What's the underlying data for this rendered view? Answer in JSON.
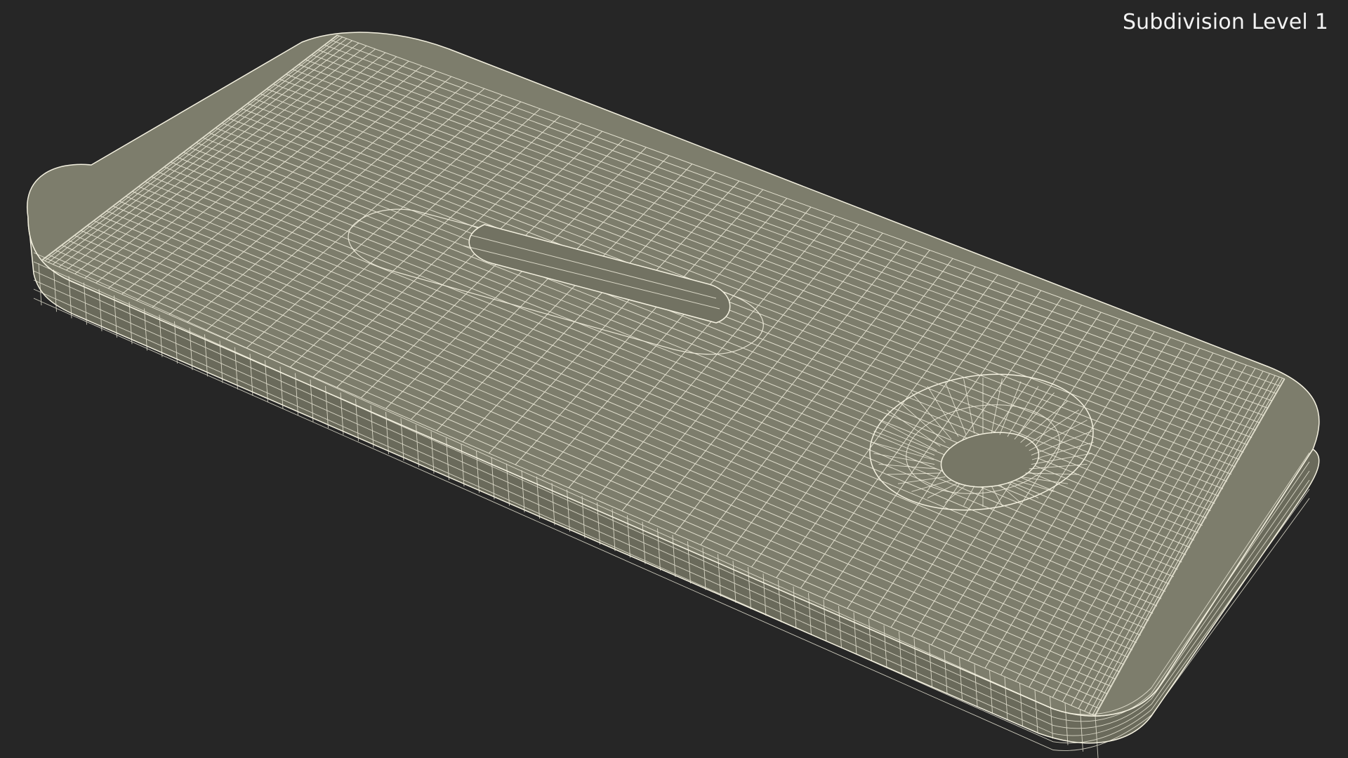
{
  "viewport": {
    "label": "Subdivision Level 1"
  },
  "colors": {
    "background": "#262626",
    "surface": "#7d7d6c",
    "surface_dark": "#6e6e5f",
    "side": "#6a6a5b",
    "wire": "#f4f1e0",
    "text": "#f2f2f2"
  },
  "mesh": {
    "subject": "rounded rectangular device shell wireframe",
    "features": [
      "slot-cutout",
      "round-lens-hole"
    ]
  }
}
